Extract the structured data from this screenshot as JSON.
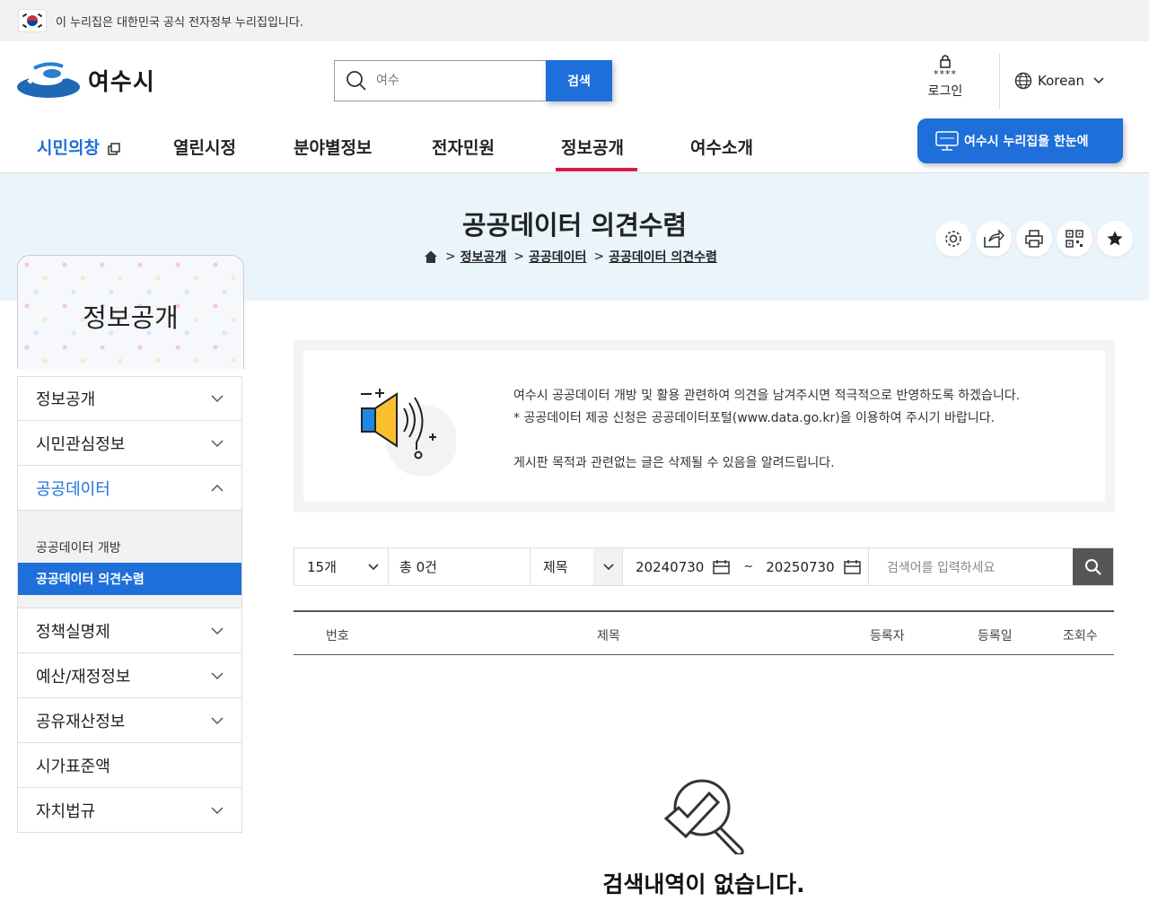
{
  "gov_banner": {
    "text": "이 누리집은 대한민국 공식 전자정부 누리집입니다."
  },
  "logo": {
    "text": "여수시"
  },
  "search": {
    "placeholder": "여수",
    "button": "검색"
  },
  "user": {
    "login_stars": "****",
    "login_label": "로그인",
    "language": "Korean"
  },
  "nav": [
    {
      "label": "시민의창"
    },
    {
      "label": "열린시정"
    },
    {
      "label": "분야별정보"
    },
    {
      "label": "전자민원"
    },
    {
      "label": "정보공개"
    },
    {
      "label": "여수소개"
    }
  ],
  "oneview_button": "여수시 누리집을 한눈에",
  "page": {
    "title": "공공데이터 의견수렴",
    "breadcrumb": [
      "정보공개",
      "공공데이터",
      "공공데이터 의견수렴"
    ]
  },
  "sidebar": {
    "title": "정보공개",
    "items": [
      {
        "label": "정보공개"
      },
      {
        "label": "시민관심정보"
      },
      {
        "label": "공공데이터"
      },
      {
        "label": "정책실명제"
      },
      {
        "label": "예산/재정정보"
      },
      {
        "label": "공유재산정보"
      },
      {
        "label": "시가표준액"
      },
      {
        "label": "자치법규"
      }
    ],
    "sub_items": [
      {
        "label": "공공데이터 개방"
      },
      {
        "label": "공공데이터 의견수렴"
      }
    ]
  },
  "notice": {
    "line1": "여수시 공공데이터 개방 및 활용 관련하여 의견을 남겨주시면 적극적으로 반영하도록 하겠습니다.",
    "line2": "* 공공데이터 제공 신청은 공공데이터포털(www.data.go.kr)을 이용하여 주시기 바랍니다.",
    "line3": "게시판 목적과 관련없는 글은 삭제될 수 있음을 알려드립니다."
  },
  "filter": {
    "page_size": "15개",
    "total": "총 0건",
    "field": "제목",
    "date_from": "20240730",
    "date_sep": "~",
    "date_to": "20250730",
    "keyword_placeholder": "검색어를 입력하세요"
  },
  "table": {
    "columns": [
      "번호",
      "제목",
      "등록자",
      "등록일",
      "조회수"
    ]
  },
  "empty_message": "검색내역이 없습니다.",
  "colors": {
    "primary": "#1e6fd9",
    "accent": "#d8194b",
    "banner": "#eaf4fb"
  }
}
